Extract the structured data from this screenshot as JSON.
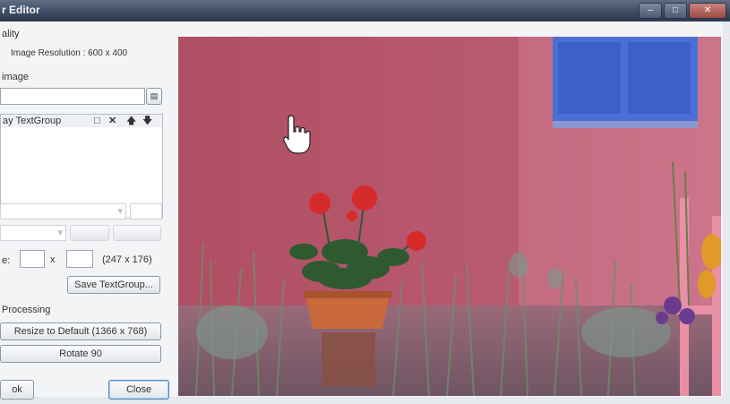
{
  "window": {
    "title": "r Editor"
  },
  "sidebar": {
    "section_properties": "ality",
    "resolution_text": "Image Resolution : 600 x 400",
    "section_image": "image",
    "textgroup_header": "ay TextGroup",
    "size_label": "e:",
    "size_readout": "(247 x 176)",
    "save_textgroup": "Save TextGroup...",
    "section_processing": "Processing",
    "resize_default": "Resize to Default (1366 x 768)",
    "rotate": "Rotate 90",
    "bottom_left_button": "ok",
    "close_button": "Close"
  }
}
